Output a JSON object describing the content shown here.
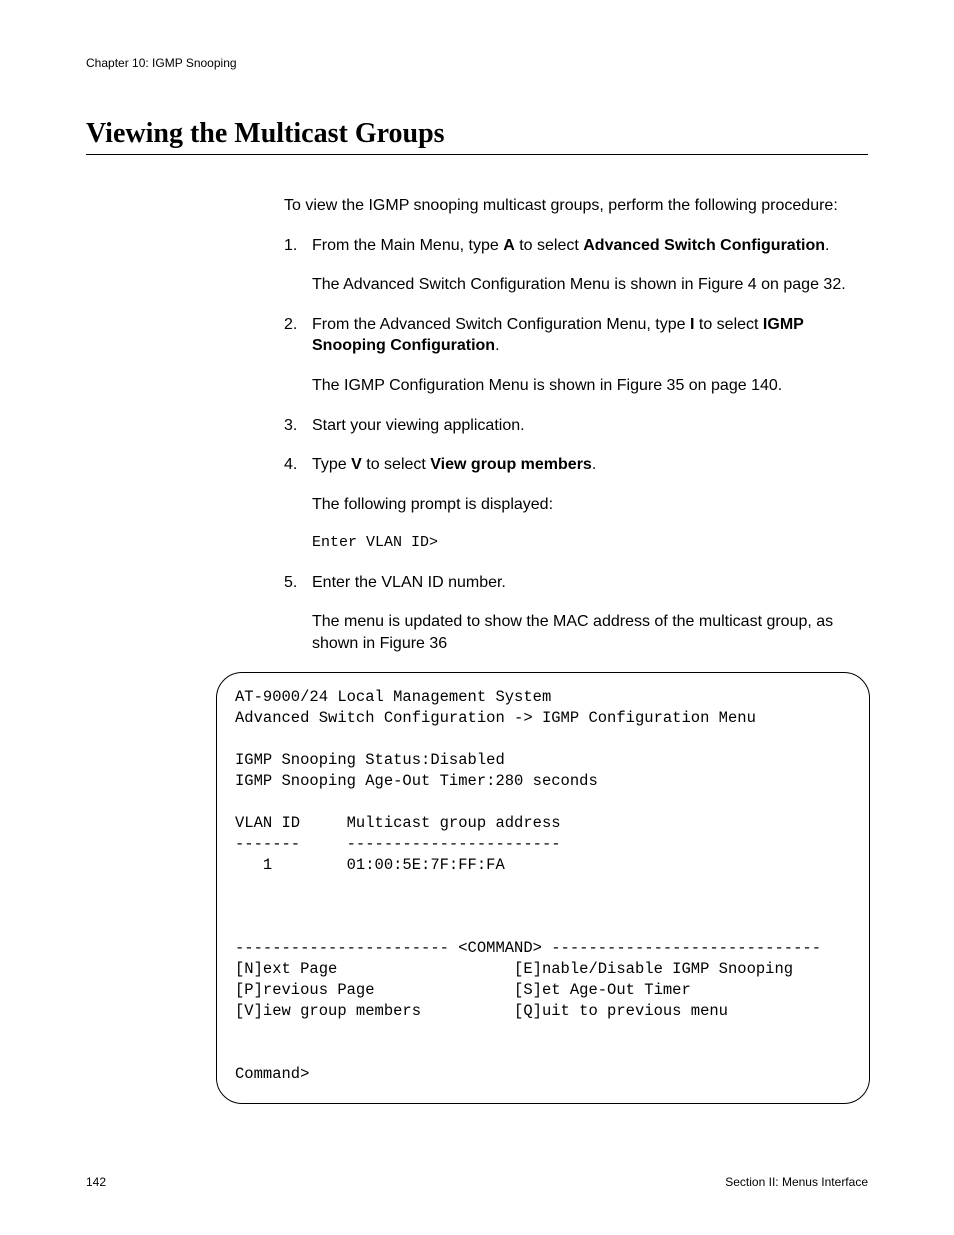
{
  "header": {
    "chapter": "Chapter 10: IGMP Snooping"
  },
  "title": "Viewing the Multicast Groups",
  "intro": "To view the IGMP snooping multicast groups, perform the following procedure:",
  "steps": {
    "s1": {
      "num": "1.",
      "pre": "From the Main Menu, type ",
      "key": "A",
      "mid": " to select ",
      "target": "Advanced Switch Configuration",
      "post": ".",
      "after": "The Advanced Switch Configuration Menu is shown in Figure 4 on page 32."
    },
    "s2": {
      "num": "2.",
      "pre": "From the Advanced Switch Configuration Menu, type ",
      "key": "I",
      "mid": " to select ",
      "target": "IGMP Snooping Configuration",
      "post": ".",
      "after": "The IGMP Configuration Menu is shown in Figure 35 on page 140."
    },
    "s3": {
      "num": "3.",
      "text": "Start your viewing application."
    },
    "s4": {
      "num": "4.",
      "pre": "Type ",
      "key": "V",
      "mid": " to select ",
      "target": "View group members",
      "post": ".",
      "after": "The following prompt is displayed:",
      "prompt": "Enter VLAN ID>"
    },
    "s5": {
      "num": "5.",
      "text": "Enter the VLAN ID number.",
      "after": "The menu is updated to show the MAC address of the multicast group, as shown in Figure 36"
    }
  },
  "terminal": "AT-9000/24 Local Management System\nAdvanced Switch Configuration -> IGMP Configuration Menu\n\nIGMP Snooping Status:Disabled\nIGMP Snooping Age-Out Timer:280 seconds\n\nVLAN ID     Multicast group address\n-------     -----------------------\n   1        01:00:5E:7F:FF:FA\n\n\n\n----------------------- <COMMAND> -----------------------------\n[N]ext Page                   [E]nable/Disable IGMP Snooping\n[P]revious Page               [S]et Age-Out Timer\n[V]iew group members          [Q]uit to previous menu\n\n\nCommand>",
  "footer": {
    "page": "142",
    "section": "Section II: Menus Interface"
  }
}
